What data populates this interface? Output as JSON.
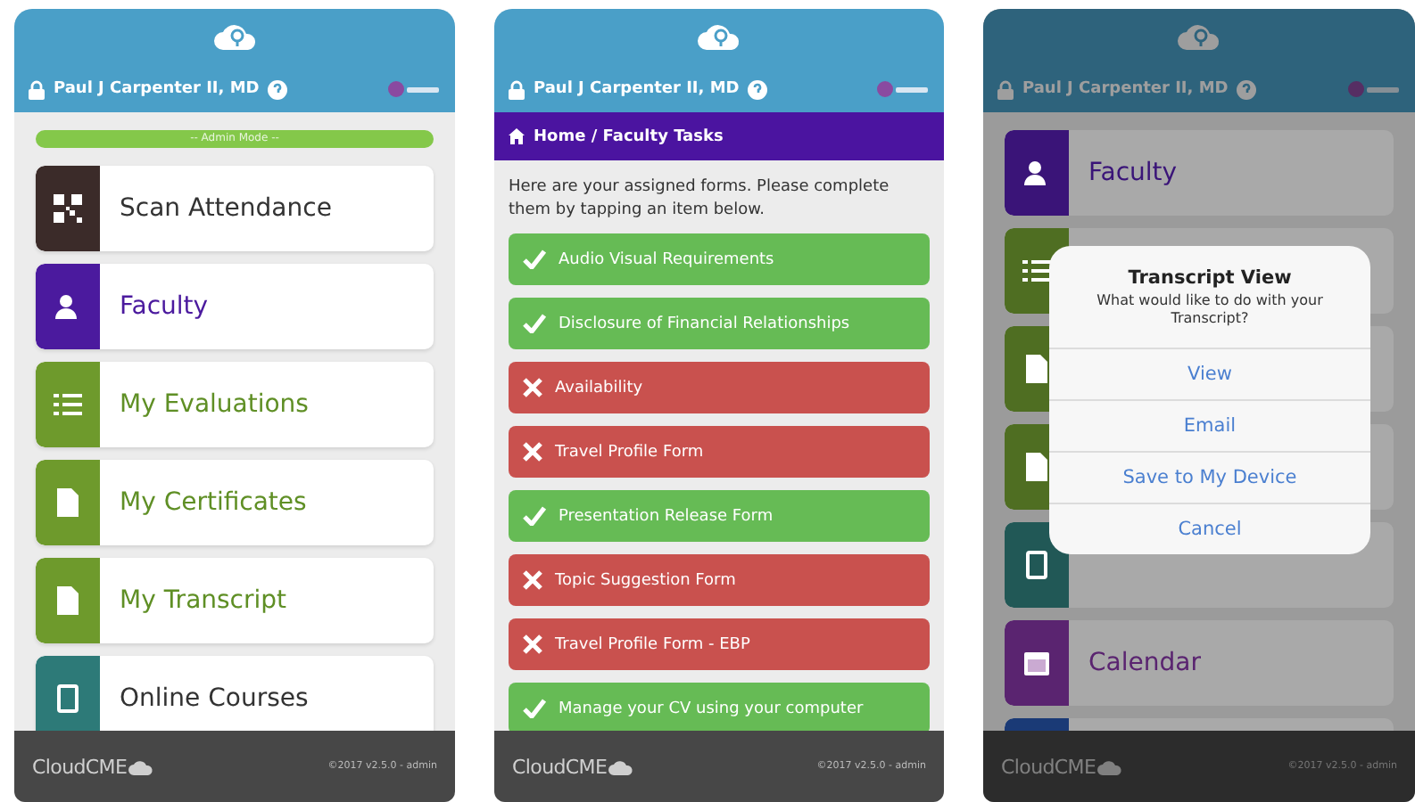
{
  "screens": [
    {
      "kind": "menu",
      "user": "Paul J Carpenter II, MD",
      "banner": "-- Admin Mode --",
      "items": [
        {
          "label": "Scan Attendance",
          "color": "#3b2b29"
        },
        {
          "label": "Faculty",
          "color": "#4b1a9e"
        },
        {
          "label": "My Evaluations",
          "color": "#6e9a2c"
        },
        {
          "label": "My Certificates",
          "color": "#6e9a2c"
        },
        {
          "label": "My Transcript",
          "color": "#6e9a2c"
        },
        {
          "label": "Online Courses",
          "color": "#2d7a78"
        }
      ],
      "footer": {
        "brand": "CloudCME",
        "version": "©2017 v2.5.0 - admin"
      }
    },
    {
      "kind": "forms",
      "user": "Paul J Carpenter II, MD",
      "breadcrumb": "Home / Faculty Tasks",
      "intro": "Here are your assigned forms. Please complete them by tapping an item below.",
      "forms": [
        {
          "label": "Audio Visual Requirements",
          "complete": true
        },
        {
          "label": "Disclosure of Financial Relationships",
          "complete": true
        },
        {
          "label": "Availability",
          "complete": false
        },
        {
          "label": "Travel Profile Form",
          "complete": false
        },
        {
          "label": "Presentation Release Form",
          "complete": true
        },
        {
          "label": "Topic Suggestion Form",
          "complete": false
        },
        {
          "label": "Travel Profile Form - EBP",
          "complete": false
        },
        {
          "label": "Manage your CV using your computer",
          "complete": true
        }
      ],
      "footer": {
        "brand": "CloudCME",
        "version": "©2017 v2.5.0 - admin"
      }
    },
    {
      "kind": "menu",
      "user": "Paul J Carpenter II, MD",
      "items": [
        {
          "label": "Faculty",
          "color": "#3a1478"
        },
        {
          "color": "#4f6e22"
        },
        {
          "color": "#4f6e22"
        },
        {
          "color": "#4f6e22"
        },
        {
          "color": "#215856"
        },
        {
          "label": "Calendar",
          "color": "#5a2470"
        },
        {
          "color": "#1a3a76"
        }
      ],
      "dialog": {
        "title": "Transcript View",
        "message": "What would like to do with your Transcript?",
        "actions": [
          "View",
          "Email",
          "Save to My Device",
          "Cancel"
        ]
      },
      "footer": {
        "brand": "CloudCME",
        "version": "©2017 v2.5.0 - admin"
      }
    }
  ]
}
